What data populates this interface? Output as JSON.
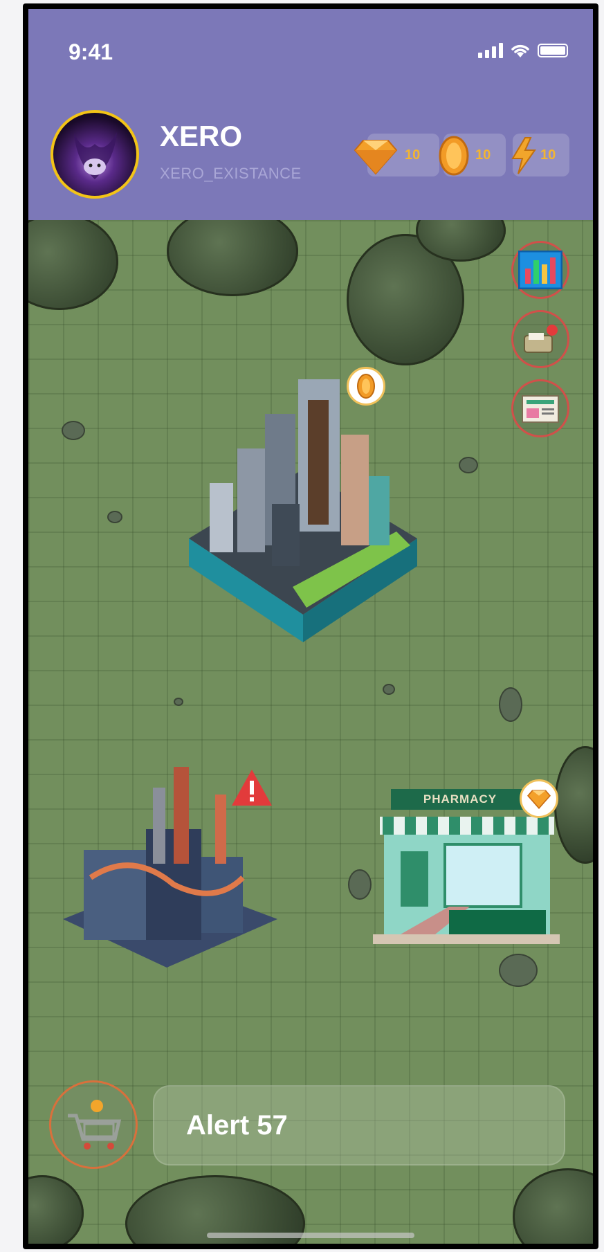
{
  "status_bar": {
    "time": "9:41",
    "icons": [
      "signal-icon",
      "wifi-icon",
      "battery-icon"
    ]
  },
  "profile": {
    "username": "XERO",
    "handle": "XERO_EXISTANCE"
  },
  "currencies": [
    {
      "name": "gem",
      "icon": "gem-icon",
      "value": "10",
      "color": "#f2a43a"
    },
    {
      "name": "coin",
      "icon": "coin-icon",
      "value": "10",
      "color": "#f2a43a"
    },
    {
      "name": "energy",
      "icon": "lightning-icon",
      "value": "10",
      "color": "#f2a43a"
    }
  ],
  "side_buttons": [
    {
      "name": "stats-button",
      "icon": "bar-chart-icon",
      "notification": false
    },
    {
      "name": "mail-button",
      "icon": "mailbox-icon",
      "notification": true
    },
    {
      "name": "news-button",
      "icon": "newspaper-icon",
      "notification": false
    }
  ],
  "buildings": [
    {
      "name": "city-district",
      "badge": "coin-icon"
    },
    {
      "name": "factory",
      "badge": "warning-icon"
    },
    {
      "name": "pharmacy",
      "sign": "PHARMACY",
      "badge": "gem-icon"
    }
  ],
  "bottom": {
    "cart_icon": "shopping-cart-icon",
    "alert_label": "Alert 57"
  },
  "colors": {
    "header": "#7c78b8",
    "map": "#728f5d",
    "avatar_ring": "#f3c417",
    "currency_value": "#f2b531",
    "alert_badge": "#e23b3b"
  }
}
